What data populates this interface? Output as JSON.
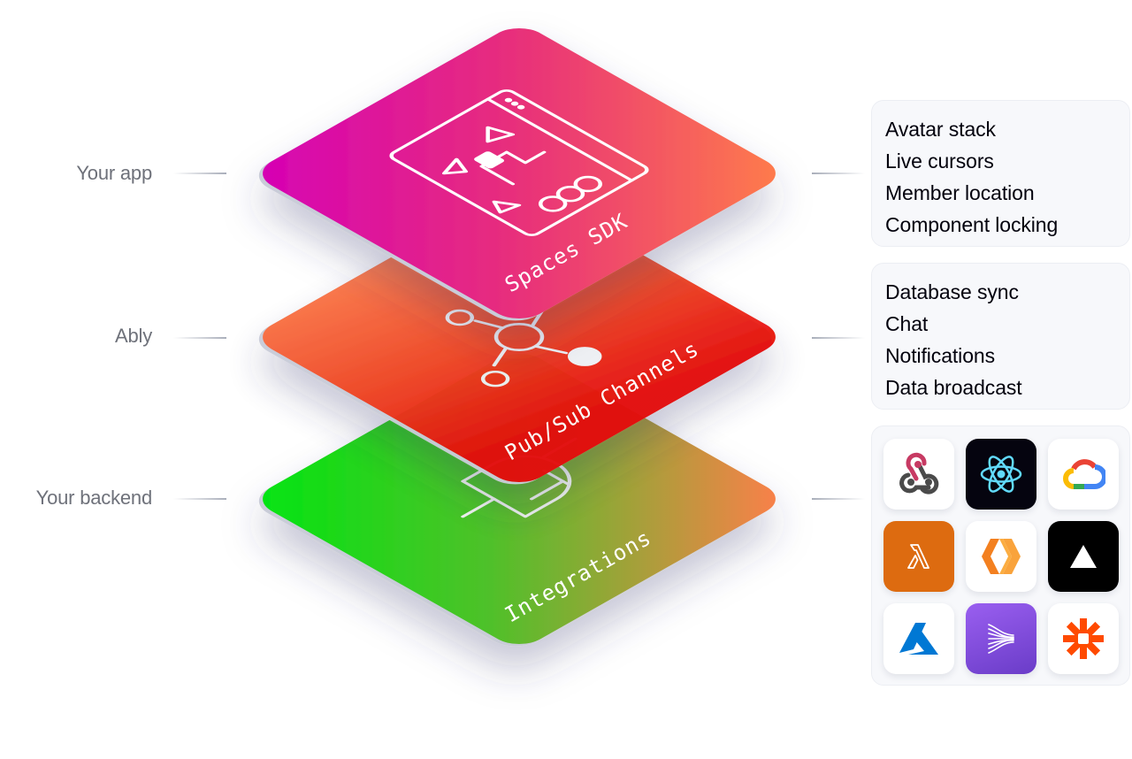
{
  "left_labels": {
    "app": "Your app",
    "ably": "Ably",
    "backend": "Your backend"
  },
  "layers": {
    "top": {
      "title": "Spaces SDK",
      "icon": "collaborative-window-icon",
      "gradient": [
        "#d500b6",
        "#ff7e4a"
      ]
    },
    "middle": {
      "title": "Pub/Sub Channels",
      "icon": "pubsub-hub-icon",
      "gradient": [
        "#ff7e4a",
        "#e40000"
      ]
    },
    "bottom": {
      "title": "Integrations",
      "icon": "plug-connector-icon",
      "gradient": [
        "#00e610",
        "#ff7e4a"
      ]
    }
  },
  "spaces_features": [
    "Avatar stack",
    "Live cursors",
    "Member location",
    "Component locking"
  ],
  "pubsub_features": [
    "Database sync",
    "Chat",
    "Notifications",
    "Data broadcast"
  ],
  "integrations": [
    {
      "name": "webhooks-icon",
      "bg": "#ffffff"
    },
    {
      "name": "react-icon",
      "bg": "#05040f"
    },
    {
      "name": "google-cloud-icon",
      "bg": "#ffffff"
    },
    {
      "name": "aws-lambda-icon",
      "bg": "#dd6b10"
    },
    {
      "name": "cloudflare-workers-icon",
      "bg": "#ffffff"
    },
    {
      "name": "vercel-icon",
      "bg": "#000000"
    },
    {
      "name": "azure-icon",
      "bg": "#ffffff"
    },
    {
      "name": "kafka-stream-icon",
      "bg": "#8a52e0"
    },
    {
      "name": "zapier-icon",
      "bg": "#ffffff"
    }
  ]
}
